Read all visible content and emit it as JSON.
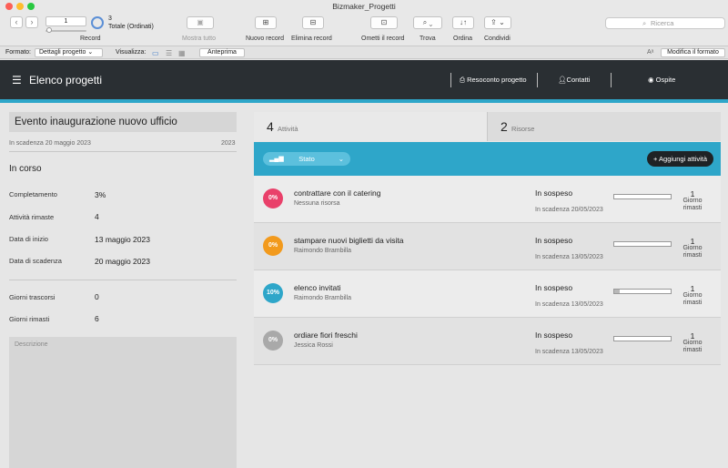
{
  "window": {
    "title": "Bizmaker_Progetti"
  },
  "toolbar": {
    "record_number": "1",
    "record_label": "Record",
    "total_count": "3",
    "total_label": "Totale (Ordinati)",
    "show_all": "Mostra tutto",
    "new_record": "Nuovo record",
    "delete_record": "Elimina record",
    "omit_record": "Ometti il record",
    "find": "Trova",
    "sort": "Ordina",
    "share": "Condividi",
    "search_placeholder": "Ricerca"
  },
  "formatbar": {
    "format_label": "Formato:",
    "layout_value": "Dettagli progetto",
    "view_label": "Visualizza:",
    "preview": "Anteprima",
    "edit_layout": "Modifica il formato"
  },
  "header": {
    "title": "Elenco progetti",
    "report": "Resoconto progetto",
    "contacts": "Contatti",
    "guest": "Ospite"
  },
  "project": {
    "title": "Evento inaugurazione nuovo ufficio",
    "due": "In scadenza 20 maggio 2023",
    "year": "2023",
    "status": "In corso",
    "fields": [
      {
        "label": "Completamento",
        "value": "3%"
      },
      {
        "label": "Attività rimaste",
        "value": "4"
      },
      {
        "label": "Data di inizio",
        "value": "13 maggio 2023"
      },
      {
        "label": "Data di scadenza",
        "value": "20 maggio 2023"
      }
    ],
    "days": [
      {
        "label": "Giorni trascorsi",
        "value": "0"
      },
      {
        "label": "Giorni rimasti",
        "value": "6"
      }
    ],
    "description_label": "Descrizione"
  },
  "tabs": [
    {
      "count": "4",
      "label": "Attività"
    },
    {
      "count": "2",
      "label": "Risorse"
    }
  ],
  "filter": {
    "stato": "Stato",
    "add": "Aggiungi attività"
  },
  "tasks": [
    {
      "badge": "0%",
      "color": "#e9406a",
      "title": "contrattare con il catering",
      "assignee": "Nessuna risorsa",
      "status": "In sospeso",
      "due": "In scadenza 20/05/2023",
      "progress": 0,
      "days": "1",
      "unit": "Giorno rimasti"
    },
    {
      "badge": "0%",
      "color": "#f29a1d",
      "title": "stampare nuovi biglietti da visita",
      "assignee": "Raimondo Brambilla",
      "status": "In sospeso",
      "due": "In scadenza 13/05/2023",
      "progress": 0,
      "days": "1",
      "unit": "Giorno rimasti"
    },
    {
      "badge": "10%",
      "color": "#2ea6c9",
      "title": "elenco invitati",
      "assignee": "Raimondo Brambilla",
      "status": "In sospeso",
      "due": "In scadenza 13/05/2023",
      "progress": 0.1,
      "days": "1",
      "unit": "Giorno rimasti"
    },
    {
      "badge": "0%",
      "color": "#a9a9a9",
      "title": "ordiare fiori freschi",
      "assignee": "Jessica Rossi",
      "status": "In sospeso",
      "due": "In scadenza 13/05/2023",
      "progress": 0,
      "days": "1",
      "unit": "Giorno rimasti"
    }
  ]
}
